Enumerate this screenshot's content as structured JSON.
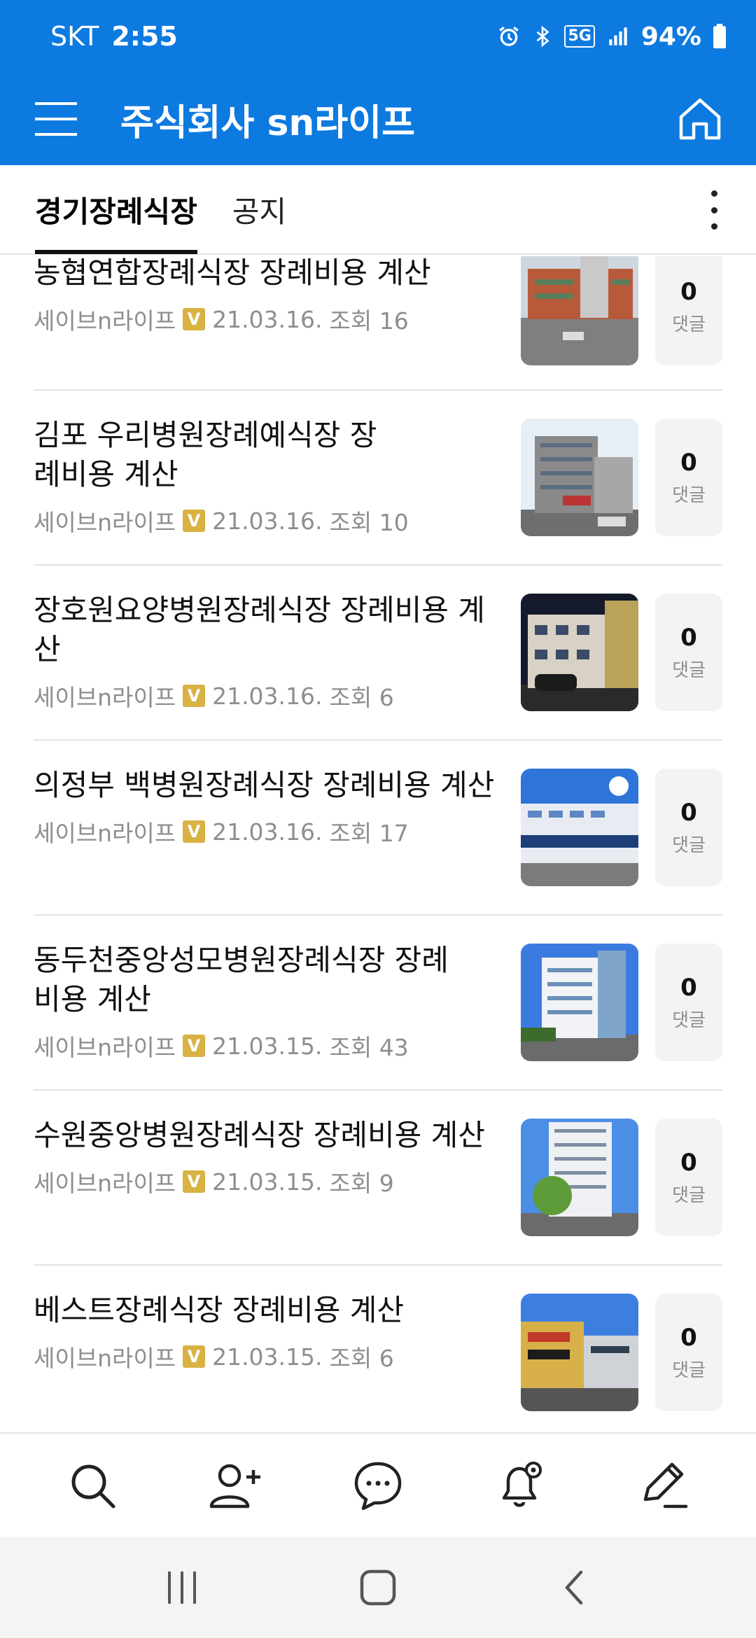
{
  "status": {
    "carrier": "SKT",
    "time": "2:55",
    "network": "5G",
    "battery": "94%"
  },
  "app": {
    "title": "주식회사 sn라이프"
  },
  "tabs": [
    {
      "label": "경기장례식장",
      "active": true
    },
    {
      "label": "공지",
      "active": false
    }
  ],
  "posts": [
    {
      "title": "농협연합장례식장 장례비용 계산",
      "author": "세이브n라이프",
      "badge": "V",
      "date": "21.03.16.",
      "views": "조회 16",
      "comments": "0",
      "comment_label": "댓글",
      "thumb": "building-brick"
    },
    {
      "title": "김포 우리병원장례예식장 장례비용 계산",
      "author": "세이브n라이프",
      "badge": "V",
      "date": "21.03.16.",
      "views": "조회 10",
      "comments": "0",
      "comment_label": "댓글",
      "thumb": "building-gray"
    },
    {
      "title": "장호원요양병원장례식장 장례비용 계산",
      "author": "세이브n라이프",
      "badge": "V",
      "date": "21.03.16.",
      "views": "조회 6",
      "comments": "0",
      "comment_label": "댓글",
      "thumb": "building-night"
    },
    {
      "title": "의정부 백병원장례식장 장례비용 계산",
      "author": "세이브n라이프",
      "badge": "V",
      "date": "21.03.16.",
      "views": "조회 17",
      "comments": "0",
      "comment_label": "댓글",
      "thumb": "building-blue"
    },
    {
      "title": "동두천중앙성모병원장례식장 장례비용 계산",
      "author": "세이브n라이프",
      "badge": "V",
      "date": "21.03.15.",
      "views": "조회 43",
      "comments": "0",
      "comment_label": "댓글",
      "thumb": "building-white"
    },
    {
      "title": "수원중앙병원장례식장 장례비용 계산",
      "author": "세이브n라이프",
      "badge": "V",
      "date": "21.03.15.",
      "views": "조회 9",
      "comments": "0",
      "comment_label": "댓글",
      "thumb": "building-tall"
    },
    {
      "title": "베스트장례식장 장례비용 계산",
      "author": "세이브n라이프",
      "badge": "V",
      "date": "21.03.15.",
      "views": "조회 6",
      "comments": "0",
      "comment_label": "댓글",
      "thumb": "street-signs"
    }
  ],
  "bottom_nav": [
    "search-icon",
    "add-friend-icon",
    "chat-icon",
    "notification-settings-icon",
    "write-icon"
  ],
  "system_nav": [
    "recents-icon",
    "home-icon",
    "back-icon"
  ],
  "colors": {
    "primary": "#0d7ae0",
    "badge": "#d9b244",
    "meta_text": "#8e8e8e",
    "comment_box": "#f2f3f5"
  }
}
